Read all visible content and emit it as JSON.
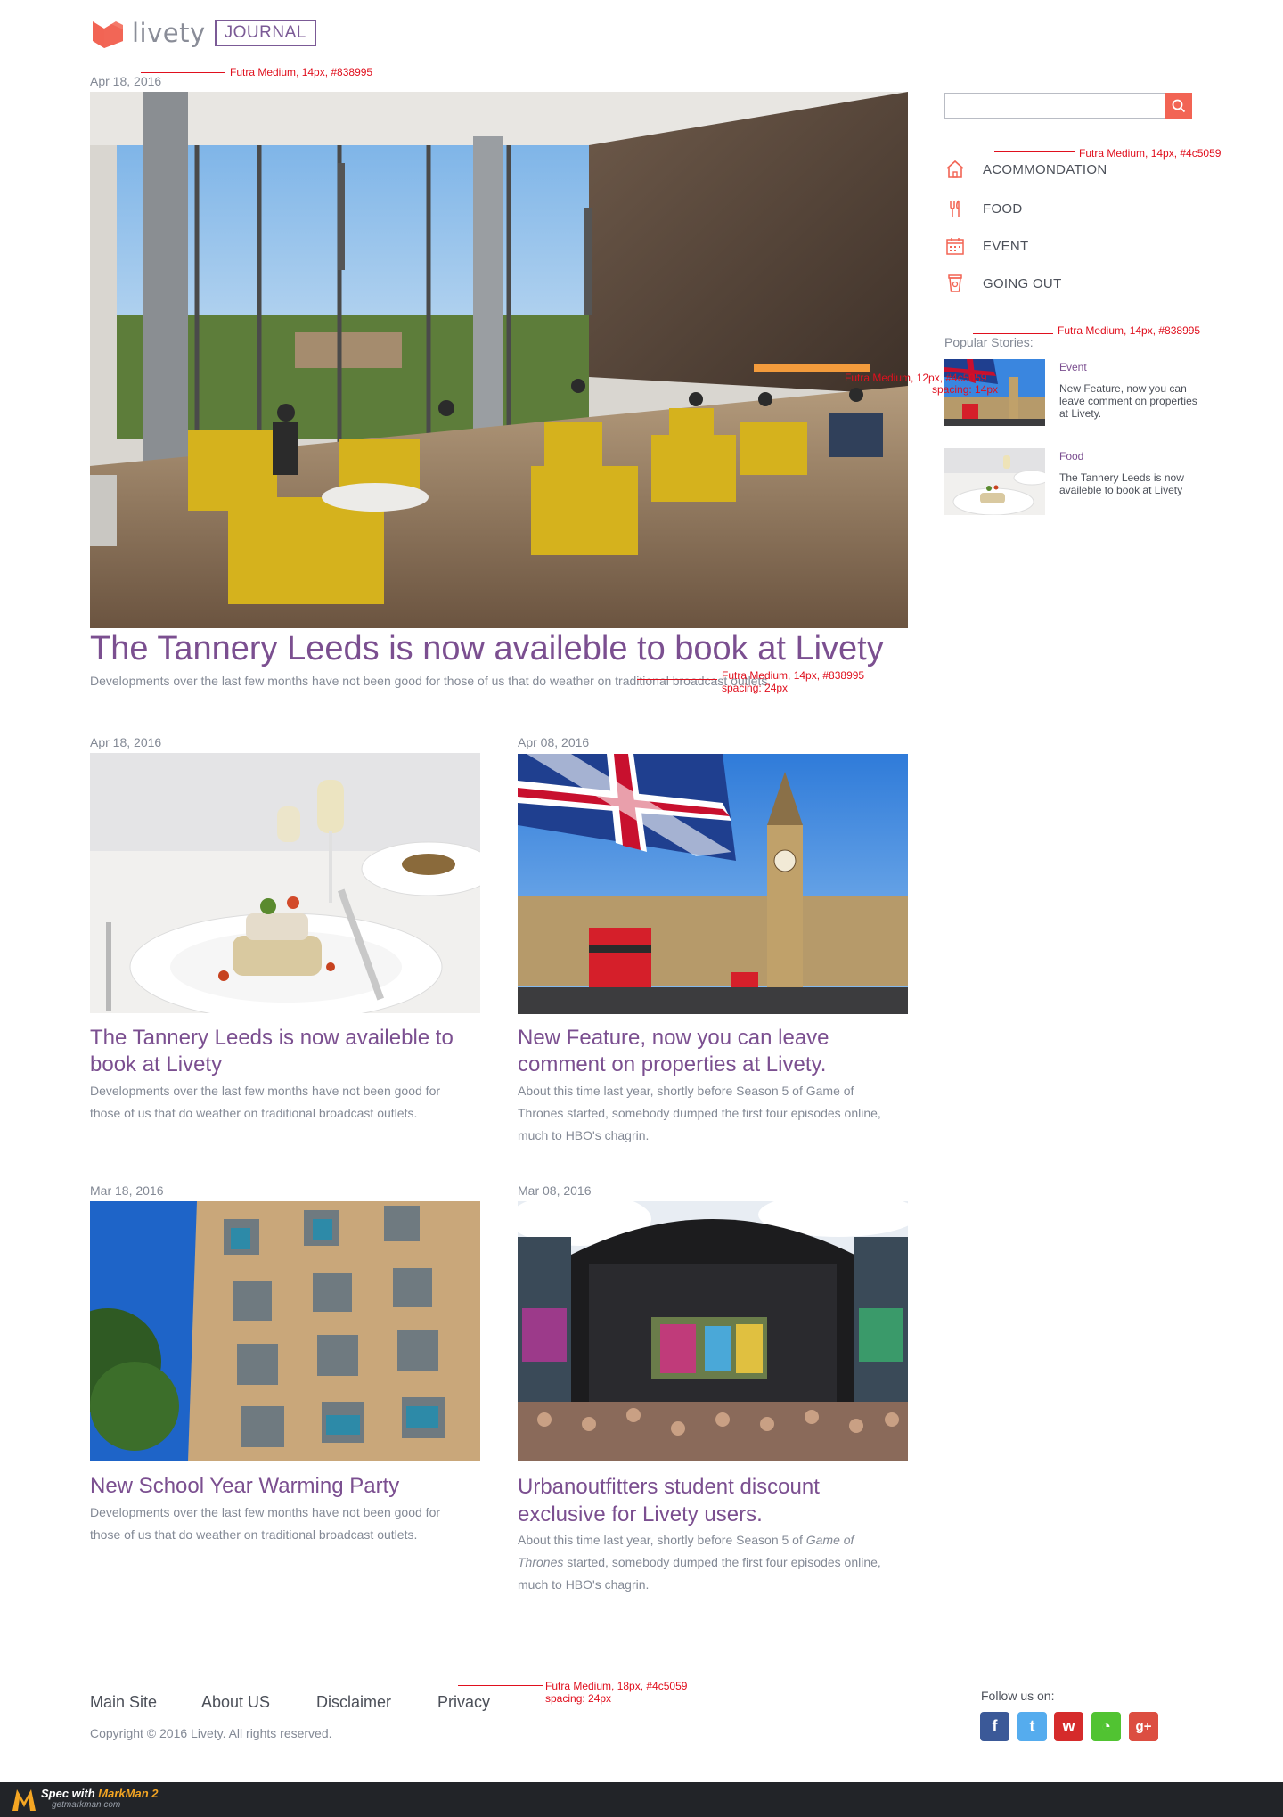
{
  "header": {
    "logo_word": "livety",
    "logo_badge": "JOURNAL"
  },
  "colors": {
    "brand_purple": "#7b4f90",
    "accent_coral": "#f26454",
    "text_dark": "#4c5059",
    "text_grey": "#838995"
  },
  "hero": {
    "date": "Apr 18, 2016",
    "title": "The Tannery Leeds is now availeble to book at Livety",
    "excerpt": "Developments over the last few months have not been good for those of us that do weather on traditional broadcast outlets."
  },
  "articles": [
    {
      "date": "Apr 18, 2016",
      "title": "The Tannery Leeds is now availeble to book at Livety",
      "excerpt": "Developments over the last few months have not been good for those of us that do weather on traditional broadcast outlets."
    },
    {
      "date": "Apr 08, 2016",
      "title": "New Feature, now you can leave comment on properties at Livety.",
      "excerpt": "About this time last year, shortly before Season 5 of Game of Thrones started, somebody dumped the first four episodes online, much to HBO's chagrin."
    },
    {
      "date": "Mar 18, 2016",
      "title": "New School Year Warming Party",
      "excerpt": "Developments over the last few months have not been good for those of us that do weather on traditional broadcast outlets."
    },
    {
      "date": "Mar 08, 2016",
      "title": "Urbanoutfitters student discount exclusive for Livety users.",
      "excerpt_before": "About this time last year, shortly before Season 5 of ",
      "excerpt_italic": "Game of Thrones",
      "excerpt_after": " started, somebody dumped the first four episodes online, much to HBO's chagrin."
    }
  ],
  "sidebar": {
    "search": {
      "placeholder": "",
      "value": "",
      "icon": "search-icon"
    },
    "categories": [
      {
        "label": "ACOMMONDATION",
        "icon": "home-icon"
      },
      {
        "label": "FOOD",
        "icon": "cutlery-icon"
      },
      {
        "label": "EVENT",
        "icon": "calendar-icon"
      },
      {
        "label": "GOING OUT",
        "icon": "cup-icon"
      }
    ],
    "popular_heading": "Popular Stories:",
    "popular": [
      {
        "category": "Event",
        "text": "New Feature, now you can leave comment on properties at Livety."
      },
      {
        "category": "Food",
        "text": "The Tannery Leeds is now availeble to book at Livety"
      }
    ]
  },
  "footer": {
    "links": [
      "Main Site",
      "About US",
      "Disclaimer",
      "Privacy"
    ],
    "copyright": "Copyright © 2016 Livety. All rights reserved.",
    "follow_label": "Follow us on:",
    "social": [
      {
        "name": "facebook",
        "glyph": "f",
        "color": "#3b5998"
      },
      {
        "name": "twitter",
        "glyph": "t",
        "color": "#55acee"
      },
      {
        "name": "weibo",
        "glyph": "w",
        "color": "#d52b2b"
      },
      {
        "name": "wechat",
        "glyph": "◔",
        "color": "#51c332"
      },
      {
        "name": "google-plus",
        "glyph": "g+",
        "color": "#dc4e41"
      }
    ]
  },
  "bottom_bar": {
    "spec_prefix": "Spec with ",
    "spec_brand": "MarkMan 2",
    "site": "getmarkman.com"
  },
  "annotations": [
    "Futra Medium, 14px, #838995",
    "Futra Medium, 14px, #4c5059",
    "Futra Medium, 14px, #838995",
    "Futra Medium, 12px, #4c5059",
    "spacing: 14px",
    "Futra Medium, 14px, #838995",
    "spacing: 24px",
    "Futra Medium, 18px, #4c5059",
    "spacing: 24px"
  ]
}
